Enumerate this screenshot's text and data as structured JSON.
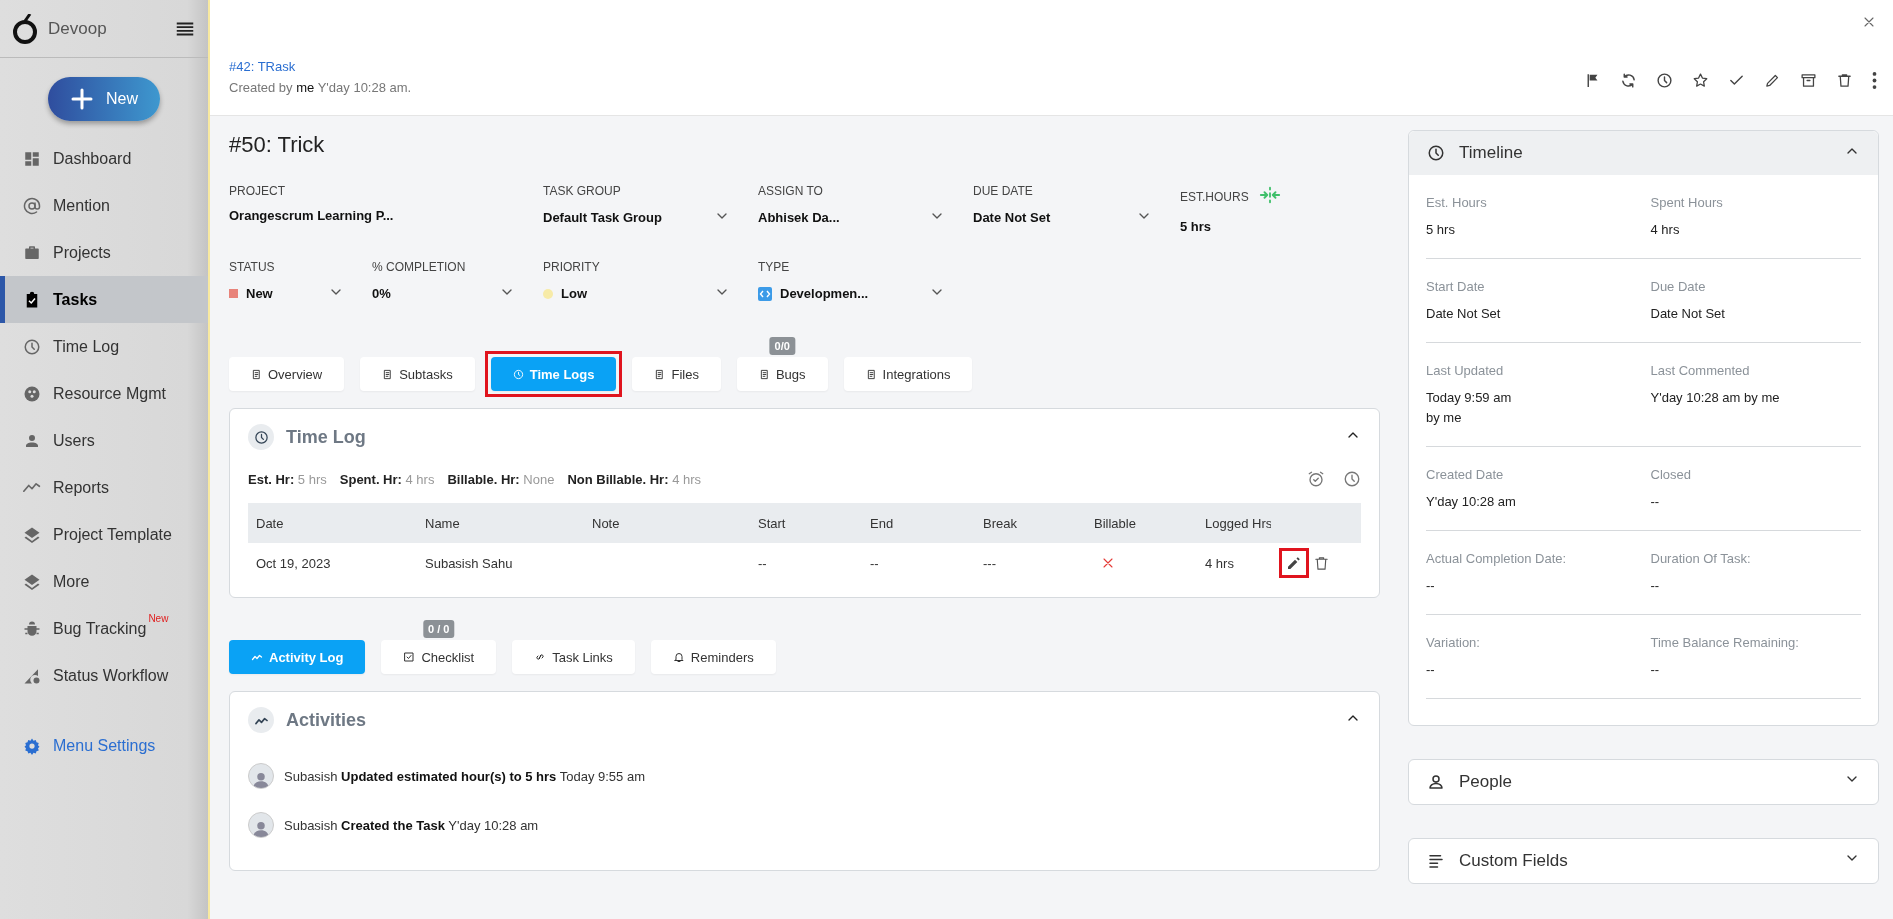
{
  "sidebar": {
    "brand": "Devoop",
    "new_button": "New",
    "items": [
      {
        "label": "Dashboard",
        "selected": false
      },
      {
        "label": "Mention",
        "selected": false
      },
      {
        "label": "Projects",
        "selected": false
      },
      {
        "label": "Tasks",
        "selected": true
      },
      {
        "label": "Time Log",
        "selected": false
      },
      {
        "label": "Resource Mgmt",
        "selected": false
      },
      {
        "label": "Users",
        "selected": false
      },
      {
        "label": "Reports",
        "selected": false
      },
      {
        "label": "Project Template",
        "selected": false
      },
      {
        "label": "More",
        "selected": false
      },
      {
        "label": "Bug Tracking",
        "selected": false,
        "badge": "New"
      },
      {
        "label": "Status Workflow",
        "selected": false
      }
    ],
    "settings": "Menu Settings"
  },
  "header": {
    "parent_task": "#42: TRask",
    "created_prefix": "Created by",
    "created_user": "me",
    "created_time": "Y'day 10:28 am."
  },
  "task": {
    "title": "#50: Trick",
    "field_rows": [
      [
        {
          "kind": "text",
          "label": "PROJECT",
          "value": "Orangescrum Learning P..."
        },
        {
          "kind": "select",
          "label": "TASK GROUP",
          "value": "Default Task Group"
        },
        {
          "kind": "select",
          "label": "ASSIGN TO",
          "value": "Abhisek Da..."
        },
        {
          "kind": "select",
          "label": "DUE DATE",
          "value": "Date Not Set"
        },
        {
          "kind": "hours",
          "label": "EST.HOURS",
          "value": "5 hrs"
        }
      ],
      [
        {
          "kind": "status",
          "label": "STATUS",
          "value": "New",
          "color": "#e8837a"
        },
        {
          "kind": "select",
          "label": "% COMPLETION",
          "value": "0%"
        },
        {
          "kind": "priority",
          "label": "PRIORITY",
          "value": "Low",
          "color": "#f7eba8"
        },
        {
          "kind": "type",
          "label": "TYPE",
          "value": "Developmen..."
        }
      ]
    ]
  },
  "tabs": [
    {
      "label": "Overview",
      "selected": false,
      "highlighted": false
    },
    {
      "label": "Subtasks",
      "selected": false,
      "highlighted": false
    },
    {
      "label": "Time Logs",
      "selected": true,
      "highlighted": true
    },
    {
      "label": "Files",
      "selected": false,
      "highlighted": false
    },
    {
      "label": "Bugs",
      "selected": false,
      "highlighted": false,
      "badge": "0/0"
    },
    {
      "label": "Integrations",
      "selected": false,
      "highlighted": false
    }
  ],
  "time_log": {
    "title": "Time Log",
    "expanded": true,
    "summary": [
      {
        "label": "Est. Hr:",
        "value": "5 hrs"
      },
      {
        "label": "Spent. Hr:",
        "value": "4 hrs"
      },
      {
        "label": "Billable. Hr:",
        "value": "None"
      },
      {
        "label": "Non Billable. Hr:",
        "value": "4 hrs"
      }
    ],
    "columns": [
      "Date",
      "Name",
      "Note",
      "Start",
      "End",
      "Break",
      "Billable",
      "Logged Hrs"
    ],
    "rows": [
      {
        "date": "Oct 19, 2023",
        "name": "Subasish Sahu",
        "start": "--",
        "end": "--",
        "break": "---",
        "billable": false,
        "logged": "4 hrs",
        "edit_highlighted": true
      }
    ]
  },
  "activity_tabs": [
    {
      "label": "Activity Log",
      "selected": true
    },
    {
      "label": "Checklist",
      "selected": false,
      "badge": "0 / 0"
    },
    {
      "label": "Task Links",
      "selected": false
    },
    {
      "label": "Reminders",
      "selected": false
    }
  ],
  "activities": {
    "title": "Activities",
    "expanded": true,
    "items": [
      {
        "text": "Subasish **Updated estimated hour(s) to 5 hrs** Today 9:55 am"
      },
      {
        "text": "Subasish **Created the Task** Y'day 10:28 am"
      }
    ]
  },
  "timeline": {
    "title": "Timeline",
    "expanded": true,
    "rows": [
      [
        {
          "label": "Est. Hours",
          "value": "5 hrs"
        },
        {
          "label": "Spent Hours",
          "value": "4 hrs"
        }
      ],
      [
        {
          "label": "Start Date",
          "value": "Date Not Set"
        },
        {
          "label": "Due Date",
          "value": "Date Not Set"
        }
      ],
      [
        {
          "label": "Last Updated",
          "value": "Today 9:59 am\nby me"
        },
        {
          "label": "Last Commented",
          "value": "Y'day 10:28 am by me"
        }
      ],
      [
        {
          "label": "Created Date",
          "value": "Y'day 10:28 am"
        },
        {
          "label": "Closed",
          "value": "--"
        }
      ],
      [
        {
          "label": "Actual Completion Date:",
          "value": "--"
        },
        {
          "label": "Duration Of Task:",
          "value": "--"
        }
      ],
      [
        {
          "label": "Variation:",
          "value": "--"
        },
        {
          "label": "Time Balance Remaining:",
          "value": "--"
        }
      ]
    ]
  },
  "people": {
    "title": "People",
    "expanded": false
  },
  "custom_fields": {
    "title": "Custom Fields",
    "expanded": false
  }
}
